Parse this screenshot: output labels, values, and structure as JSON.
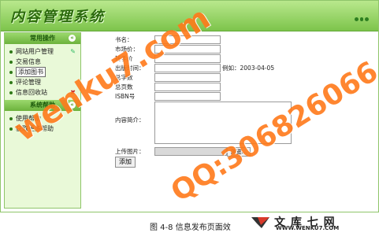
{
  "header": {
    "title": "内容管理系统"
  },
  "sidebar": {
    "groups": [
      {
        "title": "常用操作",
        "items": [
          {
            "label": "网站用户管理"
          },
          {
            "label": "交易信息"
          },
          {
            "label": "添加图书"
          },
          {
            "label": "评论管理"
          },
          {
            "label": "信息回收站"
          }
        ]
      },
      {
        "title": "系统帮助",
        "items": [
          {
            "label": "使用帮助"
          },
          {
            "label": "获取更多帮助"
          }
        ]
      }
    ]
  },
  "form": {
    "fields": [
      {
        "label": "书名："
      },
      {
        "label": "市场价："
      },
      {
        "label": "转手价"
      },
      {
        "label": "出版时间：",
        "hint": "例如：2003-04-05"
      },
      {
        "label": "总字数"
      },
      {
        "label": "总页数"
      },
      {
        "label": "ISBN号"
      }
    ],
    "content_label": "内容简介：",
    "upload_label": "上传图片：",
    "browse_label": "浏览...",
    "submit_label": "添加"
  },
  "caption": "图 4-8  信息发布页面效",
  "logo": {
    "text": "文 库 七 网",
    "sub": "WWW.WENKU7.COM"
  },
  "watermarks": [
    "wenku7.com",
    "QQ:306826066"
  ]
}
